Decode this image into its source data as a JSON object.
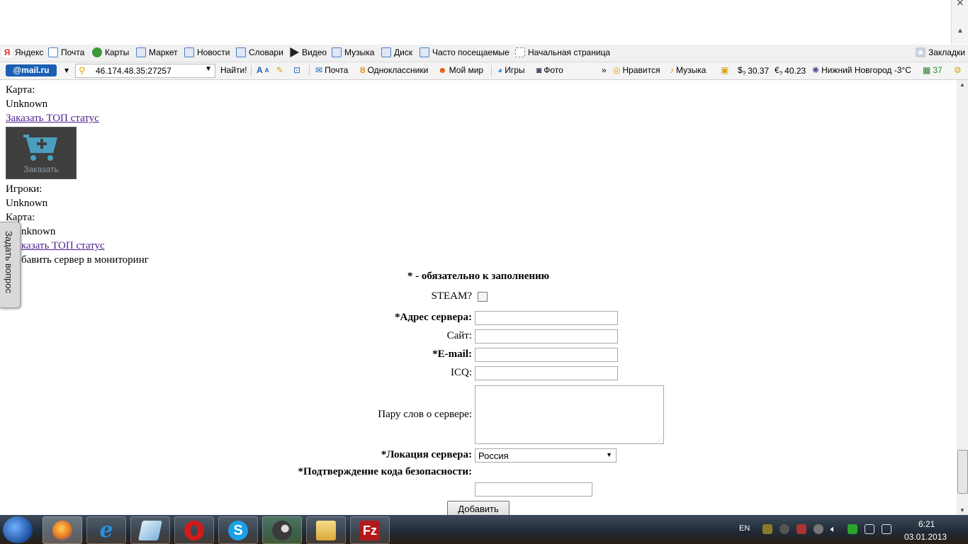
{
  "bookmarks": [
    {
      "label": "Яндекс",
      "icon": "yandex-icon",
      "color": "#e03030"
    },
    {
      "label": "Почта",
      "icon": "mail-icon",
      "color": "#4a7fc4"
    },
    {
      "label": "Карты",
      "icon": "maps-icon",
      "color": "#3a9a3a"
    },
    {
      "label": "Маркет",
      "icon": "market-icon",
      "color": "#4a7fc4"
    },
    {
      "label": "Новости",
      "icon": "news-icon",
      "color": "#4a7fc4"
    },
    {
      "label": "Словари",
      "icon": "dictionary-icon",
      "color": "#4a7fc4"
    },
    {
      "label": "Видео",
      "icon": "video-icon",
      "color": "#222222"
    },
    {
      "label": "Музыка",
      "icon": "music-icon",
      "color": "#4a7fc4"
    },
    {
      "label": "Диск",
      "icon": "disk-icon",
      "color": "#4a7fc4"
    },
    {
      "label": "Часто посещаемые",
      "icon": "frequent-icon",
      "color": "#4a7fc4"
    },
    {
      "label": "Начальная страница",
      "icon": "homepage-icon",
      "color": "#cccccc"
    }
  ],
  "bookmarks_menu": "Закладки",
  "mailbar": {
    "logo": "@mail.ru",
    "address": "46.174.48.35:27257",
    "find": "Найти!",
    "items": [
      {
        "label": "Почта",
        "icon": "envelope-icon"
      },
      {
        "label": "Одноклассники",
        "icon": "odnoklassniki-icon"
      },
      {
        "label": "Мой мир",
        "icon": "moi-mir-icon"
      },
      {
        "label": "Игры",
        "icon": "games-icon"
      },
      {
        "label": "Фото",
        "icon": "camera-icon"
      }
    ],
    "more": "»",
    "like": "Нравится",
    "music": "Музыка",
    "usd": "30.37",
    "eur": "40.23",
    "weather": "Нижний Новгород -3°C",
    "traffic": "37"
  },
  "content": {
    "map_label_1": "Карта:",
    "map_value_1": "Unknown",
    "top_status_1": "Заказать ТОП статус",
    "order_button": "Заказать",
    "players_label": "Игроки:",
    "players_value": "Unknown",
    "map_label_2": "Карта:",
    "map_value_2": "nknown",
    "top_status_2": "казать ТОП статус",
    "add_server": "бавить сервер в мониторинг",
    "ask_question": "Задать вопрос"
  },
  "form": {
    "required_note": "* - обязательно к заполнению",
    "steam_label": "STEAM?",
    "address_label": "*Адрес сервера:",
    "site_label": "Сайт:",
    "email_label": "*E-mail:",
    "icq_label": "ICQ:",
    "about_label": "Пару слов о сервере:",
    "location_label": "*Локация сервера:",
    "location_value": "Россия",
    "captcha_label": "*Подтверждение кода безопасности:",
    "submit": "Добавить"
  },
  "taskbar": {
    "apps": [
      {
        "name": "firefox-icon",
        "color": "#e8761e"
      },
      {
        "name": "internet-explorer-icon",
        "color": "#2a8fe0"
      },
      {
        "name": "notepad-icon",
        "color": "#9ec8e6"
      },
      {
        "name": "opera-icon",
        "color": "#d11a1a"
      },
      {
        "name": "skype-icon",
        "color": "#1aa0e6"
      },
      {
        "name": "steam-icon",
        "color": "#3a3a3a"
      },
      {
        "name": "explorer-folder-icon",
        "color": "#e8c25a"
      },
      {
        "name": "filezilla-icon",
        "color": "#b3191a"
      }
    ],
    "lang": "EN",
    "time": "6:21",
    "date": "03.01.2013"
  }
}
